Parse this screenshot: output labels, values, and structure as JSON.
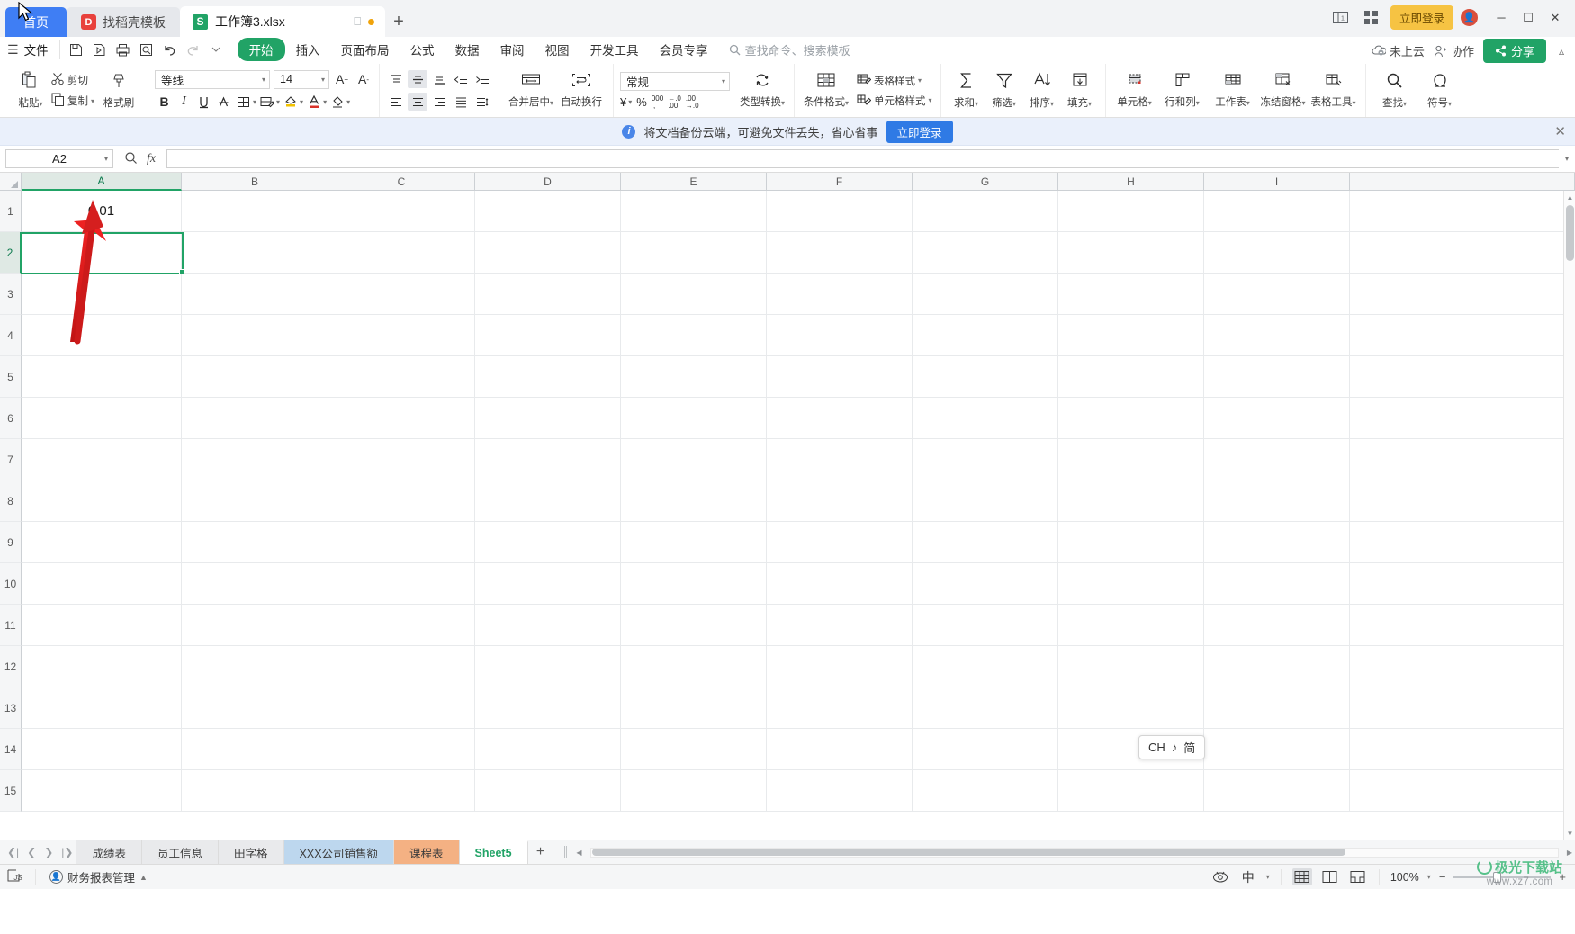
{
  "window": {
    "tabs": [
      {
        "label": "首页",
        "type": "home"
      },
      {
        "label": "找稻壳模板",
        "type": "template",
        "icon": "docer-icon"
      },
      {
        "label": "工作簿3.xlsx",
        "type": "document",
        "icon": "spreadsheet-icon"
      }
    ],
    "new_tab_label": "+",
    "vip_label": "立即登录",
    "minimize": "─",
    "maximize": "☐",
    "close": "✕"
  },
  "menubar": {
    "file_label": "文件",
    "quick_access": [
      "save-icon",
      "save-as-icon",
      "print-icon",
      "print-preview-icon",
      "undo-icon",
      "redo-icon",
      "customize-icon"
    ],
    "items": [
      {
        "label": "开始",
        "active": true
      },
      {
        "label": "插入",
        "active": false
      },
      {
        "label": "页面布局",
        "active": false
      },
      {
        "label": "公式",
        "active": false
      },
      {
        "label": "数据",
        "active": false
      },
      {
        "label": "审阅",
        "active": false
      },
      {
        "label": "视图",
        "active": false
      },
      {
        "label": "开发工具",
        "active": false
      },
      {
        "label": "会员专享",
        "active": false
      }
    ],
    "search_placeholder": "查找命令、搜索模板",
    "cloud_status": "未上云",
    "collaborate": "协作",
    "share": "分享"
  },
  "ribbon": {
    "clipboard": {
      "paste": "粘贴",
      "cut": "剪切",
      "copy": "复制",
      "format_painter": "格式刷"
    },
    "font": {
      "family": "等线",
      "size": "14",
      "grow_label": "A",
      "shrink_label": "A",
      "bold": "B",
      "italic": "I",
      "underline": "U",
      "strikethrough": "A",
      "borders": "borders-icon",
      "fill_effect": "fill-effect-icon",
      "highlight": "highlight-icon",
      "font_color": "A",
      "clear_format": "clear-format-icon"
    },
    "alignment": {
      "merge_center": "合并居中",
      "wrap_text": "自动换行"
    },
    "number": {
      "format": "常规",
      "currency": "¥",
      "percent": "%",
      "comma": "000",
      "dec_increase": ".00",
      "dec_decrease": ".00",
      "type_convert": "类型转换"
    },
    "styles": {
      "conditional_format": "条件格式",
      "table_style": "表格样式",
      "cell_style": "单元格样式"
    },
    "editing": {
      "sum": "求和",
      "filter": "筛选",
      "sort": "排序",
      "fill": "填充"
    },
    "cells": {
      "cell": "单元格",
      "rows_cols": "行和列",
      "worksheet": "工作表",
      "freeze_panes": "冻结窗格",
      "table_tools": "表格工具"
    },
    "find": {
      "find": "查找",
      "symbol": "符号"
    }
  },
  "notice": {
    "text": "将文档备份云端，可避免文件丢失，省心省事",
    "button": "立即登录",
    "close": "✕"
  },
  "formula_bar": {
    "name_box": "A2",
    "formula_value": "",
    "fx_label": "fx"
  },
  "grid": {
    "columns": [
      "A",
      "B",
      "C",
      "D",
      "E",
      "F",
      "G",
      "H",
      "I"
    ],
    "selected_column": "A",
    "rows": [
      "1",
      "2",
      "3",
      "4",
      "5",
      "6",
      "7",
      "8",
      "9",
      "10",
      "11",
      "12",
      "13",
      "14",
      "15"
    ],
    "selected_row": "2",
    "active_cell": "A2",
    "cell_values": {
      "A1": "0.01"
    },
    "annotation": {
      "type": "red-arrow",
      "color": "#d82020",
      "points_to": "A1"
    }
  },
  "ime_tooltip": {
    "lang": "CH",
    "mode_icon": "♪",
    "script": "简"
  },
  "sheet_tabs": {
    "nav": [
      "❘⟨",
      "⟨",
      "⟩",
      "⟩❘"
    ],
    "items": [
      {
        "label": "成绩表",
        "color": "",
        "active": false
      },
      {
        "label": "员工信息",
        "color": "",
        "active": false
      },
      {
        "label": "田字格",
        "color": "",
        "active": false
      },
      {
        "label": "XXX公司销售额",
        "color": "#bdd7ee",
        "active": false
      },
      {
        "label": "课程表",
        "color": "#f4b183",
        "active": false
      },
      {
        "label": "Sheet5",
        "color": "",
        "active": true
      }
    ],
    "add_label": "+"
  },
  "status_bar": {
    "plugin_label": "财务报表管理",
    "zoom": "100%",
    "view_modes": [
      "normal-view-icon",
      "page-layout-icon",
      "page-break-icon"
    ],
    "eye_icon": "reading-mode-icon",
    "lang_icon": "中",
    "zoom_out": "−",
    "zoom_in": "+",
    "watermark_line1": "极光下载站",
    "watermark_line2": "www.xz7.com"
  }
}
